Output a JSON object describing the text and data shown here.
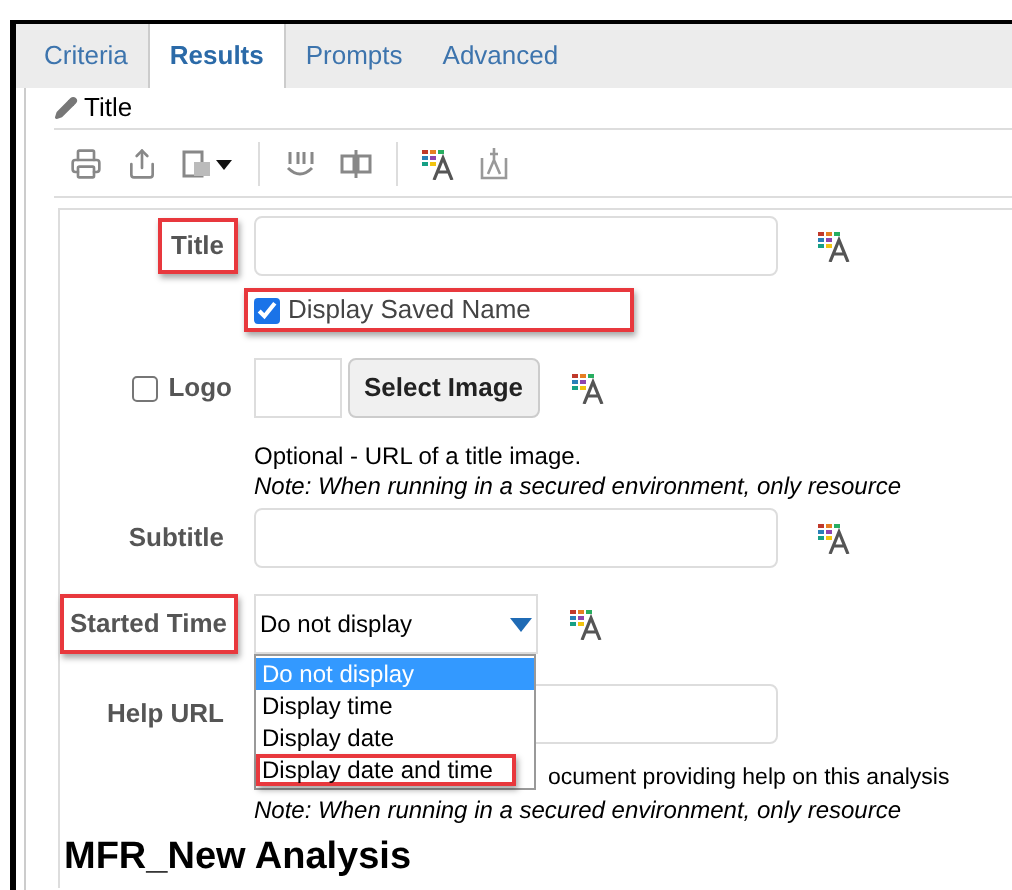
{
  "tabs": [
    {
      "label": "Criteria",
      "selected": false
    },
    {
      "label": "Results",
      "selected": true
    },
    {
      "label": "Prompts",
      "selected": false
    },
    {
      "label": "Advanced",
      "selected": false
    }
  ],
  "section_title": "Title",
  "form": {
    "title": {
      "label": "Title",
      "highlighted": true
    },
    "display_saved_name": {
      "label": "Display Saved Name",
      "checked": true,
      "highlighted": true
    },
    "logo": {
      "label": "Logo",
      "checked": false,
      "button": "Select Image",
      "hint": "Optional - URL of a title image.",
      "note": "Note: When running in a secured environment, only resource"
    },
    "subtitle": {
      "label": "Subtitle"
    },
    "started_time": {
      "label": "Started Time",
      "highlighted": true,
      "value": "Do not display",
      "expanded": true,
      "options": [
        {
          "label": "Do not display",
          "selected": true,
          "highlighted": false
        },
        {
          "label": "Display time",
          "selected": false,
          "highlighted": false
        },
        {
          "label": "Display date",
          "selected": false,
          "highlighted": false
        },
        {
          "label": "Display date and time",
          "selected": false,
          "highlighted": true
        }
      ]
    },
    "help_url": {
      "label": "Help URL",
      "hint": "ocument providing help on this analysis",
      "note": "Note: When running in a secured environment, only resource"
    }
  },
  "preview_title": "MFR_New Analysis"
}
